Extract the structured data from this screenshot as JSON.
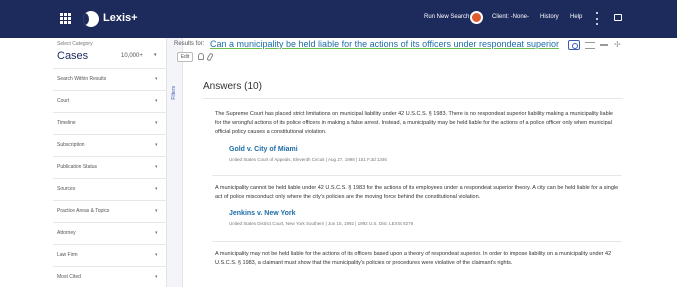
{
  "header": {
    "logo_text": "Lexis+",
    "run_new_search": "Run New Search",
    "client": "Client: -None-",
    "history": "History",
    "help": "Help",
    "accent_color": "#1d2a5c",
    "icons": [
      "grid-menu-icon",
      "lexis-logo-icon",
      "run-search-badge-icon",
      "kebab-menu-icon",
      "chat-icon"
    ]
  },
  "sidebar": {
    "select_category_label": "Select Category",
    "category": "Cases",
    "category_count": "10,000+",
    "facets": [
      {
        "label": "Search Within Results"
      },
      {
        "label": "Court"
      },
      {
        "label": "Timeline"
      },
      {
        "label": "Subscription"
      },
      {
        "label": "Publication Status"
      },
      {
        "label": "Sources"
      },
      {
        "label": "Practice Areas & Topics"
      },
      {
        "label": "Attorney"
      },
      {
        "label": "Law Firm"
      },
      {
        "label": "Most Cited"
      }
    ]
  },
  "filters_tab": {
    "label": "Filters"
  },
  "results": {
    "results_for_label": "Results for:",
    "query": "Can a municipality be held liable for the actions of its officers under respondeat superior",
    "edit_label": "Edit",
    "answers_heading": "Answers (10)",
    "cards": [
      {
        "text": "The Supreme Court has placed strict limitations on municipal liability under 42 U.S.C.S. § 1983. There is no respondeat superior liability making a municipality liable for the wrongful actions of its police officers in making a false arrest. Instead, a municipality may be held liable for the actions of a police officer only when municipal official policy causes a constitutional violation.",
        "case_title": "Gold v. City of Miami",
        "meta": "United States Court of Appeals, Eleventh Circuit | Aug 27, 1998 | 151 F.3d 1346"
      },
      {
        "text": "A municipality cannot be held liable under 42 U.S.C.S. § 1983 for the actions of its employees under a respondeat superior theory. A city can be held liable for a single act of police misconduct only where the city's policies are the moving force behind the constitutional violation.",
        "case_title": "Jenkins v. New York",
        "meta": "United States District Court, New York Southern | Jun 15, 1992 | 1992 U.S. Dist. LEXIS 8279"
      },
      {
        "text": "A municipality may not be held liable for the actions of its officers based upon a theory of respondeat superior. In order to impose liability on a municipality under 42 U.S.C.S. § 1983, a claimant must show that the municipality's policies or procedures were violative of the claimant's rights."
      }
    ]
  }
}
